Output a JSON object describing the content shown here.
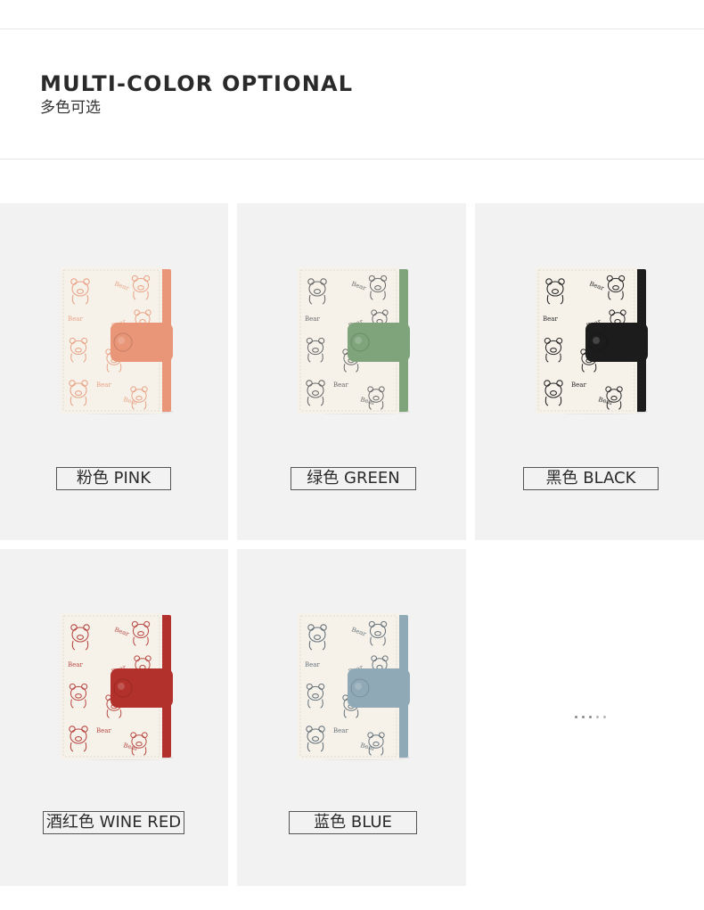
{
  "header": {
    "title_en": "MULTI-COLOR OPTIONAL",
    "title_cn": "多色可选"
  },
  "variants": [
    {
      "label": "粉色 PINK",
      "color": "#e89578",
      "print": "#e9a488"
    },
    {
      "label": "绿色 GREEN",
      "color": "#7fa47c",
      "print": "#6c6c6c"
    },
    {
      "label": "黑色 BLACK",
      "color": "#1c1c1c",
      "print": "#2a2a2a"
    },
    {
      "label": "酒红色 WINE RED",
      "color": "#b3312c",
      "print": "#b84a44"
    },
    {
      "label": "蓝色 BLUE",
      "color": "#8fa9b6",
      "print": "#68747c"
    }
  ],
  "wallet_print_text": "Bear",
  "more_indicator": "ellipsis-dots"
}
